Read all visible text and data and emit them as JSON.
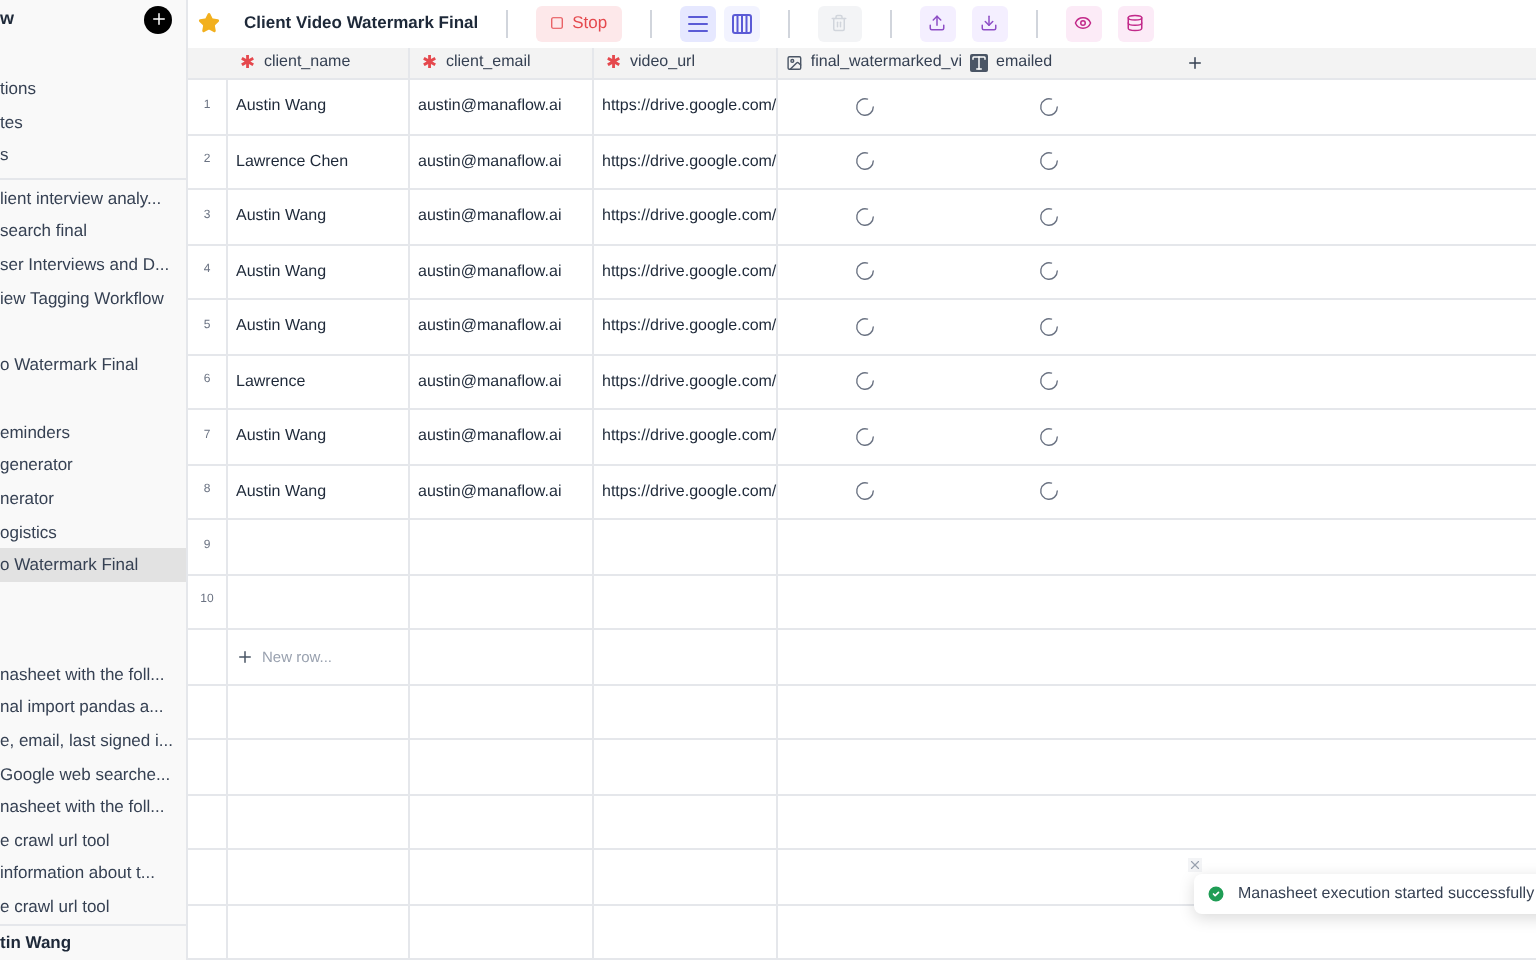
{
  "sidebar": {
    "header": "w",
    "sections": [
      {
        "items": [
          {
            "label": "tions",
            "selected": false
          },
          {
            "label": "tes",
            "selected": false
          },
          {
            "label": "s",
            "selected": false
          }
        ]
      },
      {
        "items": [
          {
            "label": "lient interview analy...",
            "selected": false
          },
          {
            "label": "search final",
            "selected": false
          },
          {
            "label": "ser Interviews and D...",
            "selected": false
          },
          {
            "label": "iew Tagging Workflow",
            "selected": false
          }
        ]
      },
      {
        "items": [
          {
            "label": "o Watermark Final",
            "selected": false
          }
        ]
      },
      {
        "items": [
          {
            "label": "eminders",
            "selected": false
          },
          {
            "label": " generator",
            "selected": false
          },
          {
            "label": "nerator",
            "selected": false
          },
          {
            "label": "ogistics",
            "selected": false
          },
          {
            "label": "o Watermark Final",
            "selected": true
          }
        ]
      },
      {
        "items": [
          {
            "label": "nasheet with the foll...",
            "selected": false
          },
          {
            "label": "nal import pandas a...",
            "selected": false
          },
          {
            "label": "e, email, last signed i...",
            "selected": false
          },
          {
            "label": "Google web searche...",
            "selected": false
          },
          {
            "label": "nasheet with the foll...",
            "selected": false
          },
          {
            "label": "e crawl url tool",
            "selected": false
          },
          {
            "label": " information about t...",
            "selected": false
          },
          {
            "label": "e crawl url tool",
            "selected": false
          }
        ]
      }
    ],
    "user": "tin Wang"
  },
  "toolbar": {
    "title": "Client Video Watermark Final",
    "stop": "Stop",
    "views": [
      {
        "kind": "rows",
        "selected": true
      },
      {
        "kind": "columns",
        "selected": false
      }
    ],
    "delete_disabled": true
  },
  "table": {
    "columns": [
      {
        "name": "client_name",
        "kind": "required",
        "marker": "✱"
      },
      {
        "name": "client_email",
        "kind": "required",
        "marker": "✱"
      },
      {
        "name": "video_url",
        "kind": "required",
        "marker": "✱"
      },
      {
        "name": "final_watermarked_vi",
        "kind": "image"
      },
      {
        "name": "emailed",
        "kind": "text"
      }
    ],
    "rows": [
      {
        "number": "1",
        "cells": [
          "Austin Wang",
          "austin@manaflow.ai",
          "https://drive.google.com/"
        ],
        "loading": true
      },
      {
        "number": "2",
        "cells": [
          "Lawrence Chen",
          "austin@manaflow.ai",
          "https://drive.google.com/"
        ],
        "loading": true
      },
      {
        "number": "3",
        "cells": [
          "Austin Wang",
          "austin@manaflow.ai",
          "https://drive.google.com/"
        ],
        "loading": true
      },
      {
        "number": "4",
        "cells": [
          "Austin Wang",
          "austin@manaflow.ai",
          "https://drive.google.com/"
        ],
        "loading": true
      },
      {
        "number": "5",
        "cells": [
          "Austin Wang",
          "austin@manaflow.ai",
          "https://drive.google.com/"
        ],
        "loading": true
      },
      {
        "number": "6",
        "cells": [
          "Lawrence",
          "austin@manaflow.ai",
          "https://drive.google.com/"
        ],
        "loading": true
      },
      {
        "number": "7",
        "cells": [
          "Austin Wang",
          "austin@manaflow.ai",
          "https://drive.google.com/"
        ],
        "loading": true
      },
      {
        "number": "8",
        "cells": [
          "Austin Wang",
          "austin@manaflow.ai",
          "https://drive.google.com/"
        ],
        "loading": true
      },
      {
        "number": "9",
        "cells": [],
        "loading": false
      },
      {
        "number": "10",
        "cells": [],
        "loading": false
      }
    ],
    "new_row": "New row..."
  },
  "toast": {
    "message": "Manasheet execution started successfully"
  }
}
